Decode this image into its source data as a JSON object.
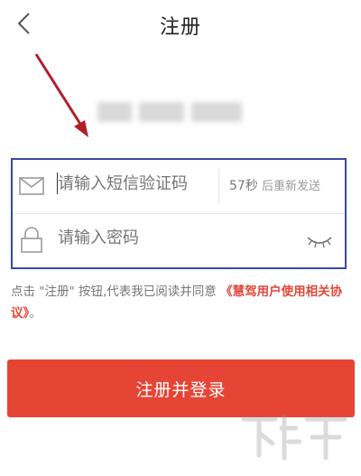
{
  "header": {
    "title": "注册",
    "back_icon": "chevron-left-icon"
  },
  "annotation_arrow_color": "#b0202a",
  "phone": {
    "blurred": true
  },
  "form": {
    "border_color": "#3a4a9e",
    "code_placeholder": "请输入短信验证码",
    "code_icon": "envelope-icon",
    "resend_seconds": "57秒",
    "resend_label": "后重新发送",
    "password_placeholder": "请输入密码",
    "password_icon": "lock-icon",
    "visibility_icon": "eye-closed-icon"
  },
  "agreement": {
    "prefix": "点击 \"注册\" 按钮,代表我已阅读并同意 ",
    "link": "《慧驾用户使用相关协议》",
    "suffix": "。"
  },
  "submit_label": "注册并登录",
  "colors": {
    "accent": "#e64536",
    "link": "#e2473a"
  }
}
